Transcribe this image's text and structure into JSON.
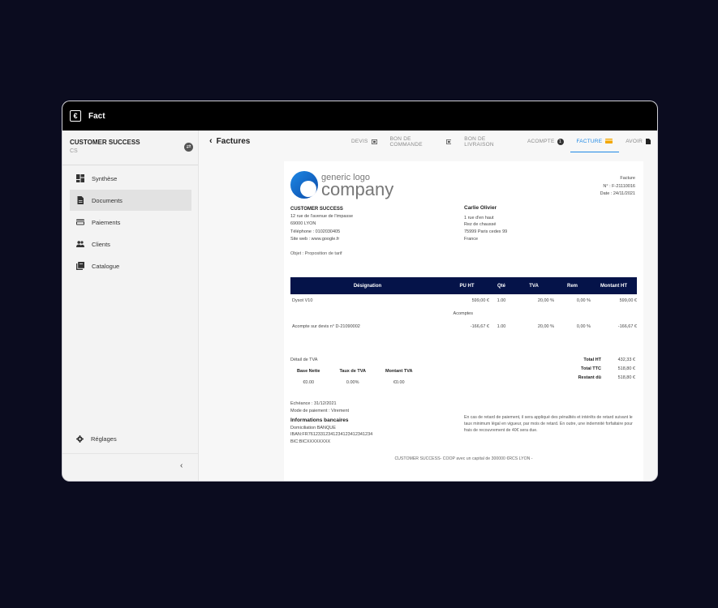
{
  "app": {
    "title": "Fact",
    "logo_glyph": "€"
  },
  "sidebar": {
    "org_name": "CUSTOMER SUCCESS",
    "org_code": "CS",
    "items": [
      {
        "label": "Synthèse",
        "icon": "dashboard-icon"
      },
      {
        "label": "Documents",
        "icon": "document-icon"
      },
      {
        "label": "Paiements",
        "icon": "card-icon"
      },
      {
        "label": "Clients",
        "icon": "people-icon"
      },
      {
        "label": "Catalogue",
        "icon": "library-icon"
      }
    ],
    "settings_label": "Réglages",
    "collapse_glyph": "‹"
  },
  "header": {
    "back_label": "Factures",
    "tabs": [
      {
        "label": "DEVIS"
      },
      {
        "label": "BON DE COMMANDE"
      },
      {
        "label": "BON DE LIVRAISON"
      },
      {
        "label": "ACOMPTE",
        "badge": "1"
      },
      {
        "label": "FACTURE"
      },
      {
        "label": "AVOIR"
      }
    ],
    "active_tab": "FACTURE",
    "accent_color": "#1e88e5"
  },
  "invoice": {
    "logo": {
      "line1": "generic logo",
      "line2": "company"
    },
    "meta": {
      "type": "Facture",
      "number_label": "N° :",
      "number": "F-21110016",
      "date_label": "Date :",
      "date": "24/11/2021"
    },
    "seller": {
      "name": "CUSTOMER SUCCESS",
      "address1": "12 rue de l'avenue de l'impasse",
      "address2": "69000 LYON",
      "phone": "Téléphone : 0102030405",
      "website": "Site web :   www.google.fr"
    },
    "buyer": {
      "name": "Carlie Olivier",
      "address1": "1 rue d'en haut",
      "address2": "Rez de chaussé",
      "address3": "75999 Paris cedex 99",
      "country": "France"
    },
    "subject": "Objet : Proposition de tarif",
    "table": {
      "header_color": "#051349",
      "columns": [
        "Désignation",
        "PU HT",
        "Qté",
        "TVA",
        "Rem",
        "Montant HT"
      ],
      "row1": {
        "des": "Dysot V10",
        "pu": "599,00 €",
        "qte": "1.00",
        "tva": "20,00 %",
        "rem": "0,00 %",
        "mt": "599,00 €"
      },
      "section_label": "Acomptes",
      "row2": {
        "des": "Acompte sur devis n° D-21090002",
        "pu": "-166,67 €",
        "qte": "1.00",
        "tva": "20,00 %",
        "rem": "0,00 %",
        "mt": "-166,67 €"
      }
    },
    "tva_detail": {
      "title": "Détail de TVA",
      "h_base": "Base Nette",
      "h_rate": "Taux de TVA",
      "h_amount": "Montant TVA",
      "base": "€0.00",
      "rate": "0.00%",
      "amount": "€0.00"
    },
    "totals": {
      "ht_label": "Total HT",
      "ht": "432,33 €",
      "ttc_label": "Total TTC",
      "ttc": "518,80 €",
      "due_label": "Restant dû",
      "due": "518,80 €"
    },
    "payment": {
      "due_date": "Echéance : 31/12/2021",
      "mode": "Mode de paiement : Virement",
      "bank_title": "Informations bancaires",
      "domiciliation": "Domiciliation BANQUE",
      "iban": "IBAN:FR76123312341234123412341234",
      "bic": "BIC:BICXXXXXXXX"
    },
    "notice": "En cas de retard de paiement, il sera appliqué des pénalités et intérêts de retard suivant le taux minimum légal en vigueur, par mois de retard. En outre, une indemnité forfaitaire pour frais de recouvrement de 40€ sera due.",
    "footer": "CUSTOMER SUCCESS- COOP avec un capital de 300000 €RCS LYON -"
  }
}
